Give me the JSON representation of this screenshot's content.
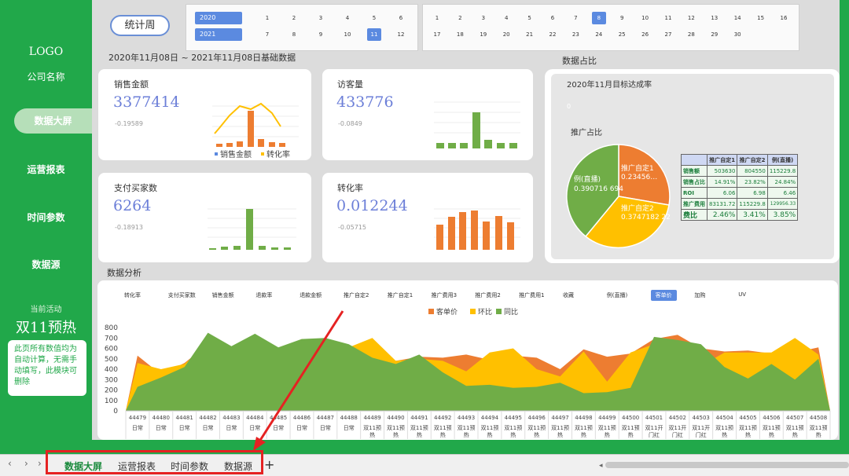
{
  "sidebar": {
    "logo": "LOGO",
    "company": "公司名称",
    "nav": [
      "数据大屏",
      "运营报表",
      "时间参数",
      "数据源"
    ],
    "activity_label": "当前活动",
    "activity_name": "双11预热",
    "note": "此页所有数值均为自动计算，无需手动填写，此模块可删除"
  },
  "filter": {
    "stat_button": "统计周",
    "years": [
      "2020",
      "2021"
    ],
    "months": [
      "1",
      "2",
      "3",
      "4",
      "5",
      "6",
      "7",
      "8",
      "9",
      "10",
      "11",
      "12"
    ],
    "selected_month": "11",
    "days": [
      "1",
      "2",
      "3",
      "4",
      "5",
      "6",
      "7",
      "8",
      "9",
      "10",
      "11",
      "12",
      "13",
      "14",
      "15",
      "16",
      "17",
      "18",
      "19",
      "20",
      "21",
      "22",
      "23",
      "24",
      "25",
      "26",
      "27",
      "28",
      "29",
      "30"
    ],
    "selected_day": "8"
  },
  "date_range": "2020年11月08日 ~ 2021年11月08日基础数据",
  "sections": {
    "share": "数据占比",
    "analysis": "数据分析"
  },
  "kpis": [
    {
      "label": "销售金额",
      "value": "3377414",
      "sub": "-0.19589",
      "legend": [
        "销售金额",
        "转化率"
      ]
    },
    {
      "label": "访客量",
      "value": "433776",
      "sub": "-0.0849"
    },
    {
      "label": "支付买家数",
      "value": "6264",
      "sub": "-0.18913"
    },
    {
      "label": "转化率",
      "value": "0.012244",
      "sub": "-0.05715"
    }
  ],
  "share_panel": {
    "target_title": "2020年11月目标达成率",
    "target_value": "0",
    "pie_title": "推广占比",
    "pie_labels": [
      {
        "name": "推广自定1",
        "value": "0.23456…"
      },
      {
        "name": "推广自定2",
        "value": "0.3747182 22"
      },
      {
        "name": "例(直播)",
        "value": "0.390716 694"
      }
    ],
    "colors": {
      "orange": "#ed7d31",
      "yellow": "#ffc000",
      "green": "#70ad47"
    },
    "table": {
      "headers": [
        "",
        "推广自定1",
        "推广自定2",
        "例(直播)"
      ],
      "rows": [
        [
          "销售额",
          "503630",
          "804550",
          "115229.8"
        ],
        [
          "销售占比",
          "14.91%",
          "23.82%",
          "24.84%"
        ],
        [
          "ROI",
          "6.06",
          "6.98",
          "6.46"
        ],
        [
          "推广费用",
          "83131.72",
          "115229.8",
          "129956.33"
        ],
        [
          "费比",
          "2.46%",
          "3.41%",
          "3.85%"
        ]
      ]
    }
  },
  "analysis": {
    "tabs": [
      "转化率",
      "支付买家数",
      "销售金额",
      "退款率",
      "退款金额",
      "推广自定2",
      "推广自定1",
      "推广费用3",
      "推广费用2",
      "推广费用1",
      "收藏",
      "例(直播)",
      "客单价",
      "加购",
      "UV"
    ],
    "active_tab": "客单价",
    "legend": [
      "客单价",
      "环比",
      "同比"
    ]
  },
  "chart_data": {
    "type": "area",
    "x": [
      "44479",
      "44480",
      "44481",
      "44482",
      "44483",
      "44484",
      "44485",
      "44486",
      "44487",
      "44488",
      "44489",
      "44490",
      "44491",
      "44492",
      "44493",
      "44494",
      "44495",
      "44496",
      "44497",
      "44498",
      "44499",
      "44500",
      "44501",
      "44502",
      "44503",
      "44504",
      "44505",
      "44506",
      "44507",
      "44508"
    ],
    "x_sub": [
      "日常",
      "日常",
      "日常",
      "日常",
      "日常",
      "日常",
      "日常",
      "日常",
      "日常",
      "日常",
      "双11预热",
      "双11预热",
      "双11预热",
      "双11预热",
      "双11预热",
      "双11预热",
      "双11预热",
      "双11预热",
      "双11预热",
      "双11预热",
      "双11预热",
      "双11预热",
      "双11开门红",
      "双11开门红",
      "双11开门红",
      "双11预热",
      "双11预热",
      "双11预热",
      "双11预热",
      "双11预热"
    ],
    "ylim": [
      0,
      800
    ],
    "yticks": [
      0,
      100,
      200,
      300,
      400,
      500,
      600,
      700,
      800
    ],
    "series": [
      {
        "name": "客单价",
        "values": [
          530,
          350,
          460,
          640,
          560,
          650,
          590,
          690,
          610,
          620,
          520,
          480,
          520,
          510,
          540,
          490,
          530,
          510,
          400,
          590,
          520,
          550,
          690,
          730,
          600,
          570,
          580,
          550,
          560,
          610
        ]
      },
      {
        "name": "环比",
        "values": [
          460,
          400,
          450,
          640,
          580,
          600,
          560,
          640,
          620,
          610,
          700,
          480,
          500,
          480,
          380,
          560,
          600,
          400,
          330,
          570,
          280,
          560,
          640,
          580,
          430,
          560,
          560,
          560,
          700,
          540
        ]
      },
      {
        "name": "同比",
        "values": [
          230,
          320,
          420,
          750,
          620,
          740,
          610,
          690,
          700,
          640,
          510,
          450,
          540,
          370,
          240,
          250,
          220,
          230,
          270,
          170,
          180,
          220,
          710,
          680,
          640,
          420,
          310,
          450,
          300,
          500
        ]
      }
    ]
  },
  "sheets": [
    "数据大屏",
    "运营报表",
    "时间参数",
    "数据源"
  ],
  "active_sheet": "数据大屏"
}
